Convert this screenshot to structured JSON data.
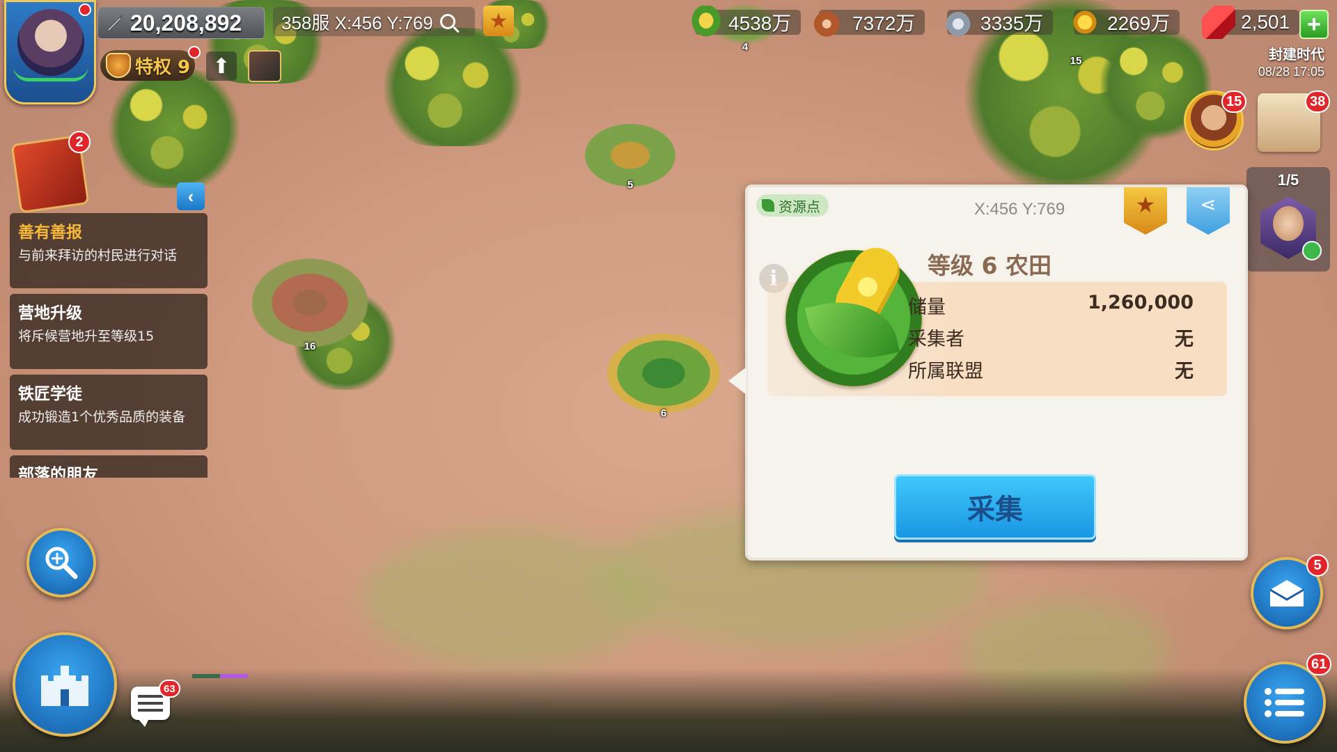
{
  "top": {
    "power": "20,208,892",
    "location": "358服 X:456 Y:769",
    "vip": "特权 9",
    "resources": [
      {
        "icon": "food-icon",
        "value": "4538万"
      },
      {
        "icon": "wood-icon",
        "value": "7372万"
      },
      {
        "icon": "stone-icon",
        "value": "3335万"
      },
      {
        "icon": "gold-icon",
        "value": "2269万"
      },
      {
        "icon": "gem-icon",
        "value": "2,501"
      }
    ],
    "era": "封建时代",
    "datetime": "08/28 17:05"
  },
  "badges": {
    "quest_book": "2",
    "commander": "15",
    "scroll": "38",
    "mail": "5",
    "menu": "61",
    "chat": "63"
  },
  "hero_panel": {
    "count": "1/5"
  },
  "quests": [
    {
      "title": "善有善报",
      "desc": "与前来拜访的村民进行对话"
    },
    {
      "title": "营地升级",
      "desc": "将斥候营地升至等级15"
    },
    {
      "title": "铁匠学徒",
      "desc": "成功锻造1个优秀品质的装备"
    },
    {
      "title": "部落的朋友",
      "desc": ""
    }
  ],
  "map": {
    "tile_levels": [
      "5",
      "16",
      "6",
      "4",
      "15"
    ]
  },
  "panel": {
    "tag": "资源点",
    "coord": "X:456 Y:769",
    "title": "等级 6 农田",
    "rows": [
      {
        "label": "储量",
        "value": "1,260,000"
      },
      {
        "label": "采集者",
        "value": "无"
      },
      {
        "label": "所属联盟",
        "value": "无"
      }
    ],
    "gather_label": "采集"
  },
  "colors": {
    "accent_gold": "#f6b93a",
    "button_blue": "#1a96e4",
    "badge_red": "#e0262b"
  }
}
